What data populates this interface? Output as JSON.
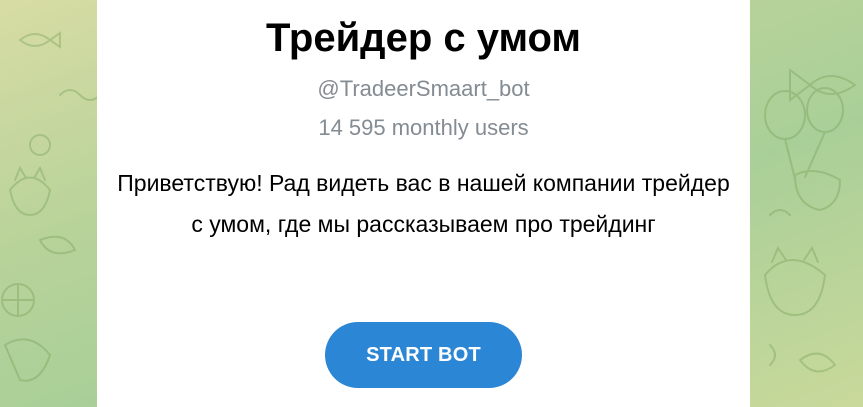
{
  "bot": {
    "name": "Трейдер с умом",
    "username": "@TradeerSmaart_bot",
    "monthly_users": "14 595 monthly users",
    "description": "Приветствую! Рад видеть вас в нашей компании трейдер с умом, где мы рассказываем про трейдинг",
    "start_button_label": "START BOT"
  },
  "colors": {
    "accent": "#2c86d6",
    "muted_text": "#838b93",
    "background_green": "#b8d39a"
  },
  "background": {
    "pattern_icons": [
      "fish-icon",
      "balloon-icon",
      "cat-icon",
      "ball-icon",
      "leaf-icon"
    ]
  }
}
